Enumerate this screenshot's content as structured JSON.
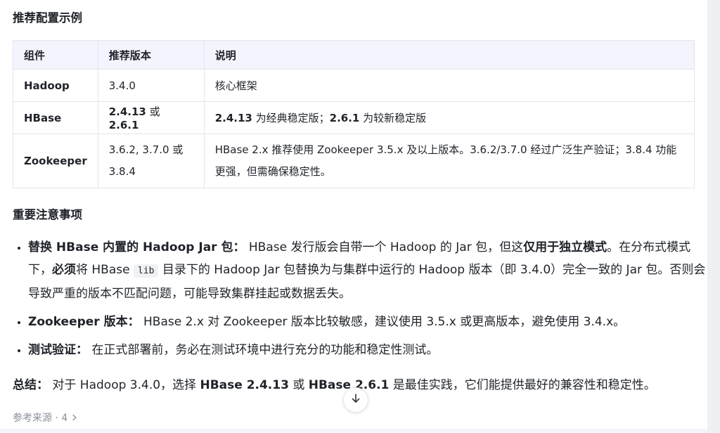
{
  "section1_title": "推荐配置示例",
  "table": {
    "headers": [
      "组件",
      "推荐版本",
      "说明"
    ],
    "rows": [
      {
        "component": "Hadoop",
        "version": "3.4.0",
        "note": "核心框架"
      },
      {
        "component": "HBase",
        "version_a": "2.4.13",
        "version_or": " 或 ",
        "version_b": "2.6.1",
        "note_a": "2.4.13",
        "note_a_text": " 为经典稳定版；",
        "note_b": "2.6.1",
        "note_b_text": " 为较新稳定版"
      },
      {
        "component": "Zookeeper",
        "version_line1": "3.6.2, 3.7.0 或",
        "version_line2": "3.8.4",
        "note_line1": "HBase 2.x 推荐使用 Zookeeper 3.5.x 及以上版本。3.6.2/3.7.0 经过广泛生产验证；3.8.4 功能",
        "note_line2": "更强，但需确保稳定性。"
      }
    ]
  },
  "section2_title": "重要注意事项",
  "notes": [
    {
      "title": "替换 HBase 内置的 Hadoop Jar 包：",
      "t1": " HBase 发行版会自带一个 Hadoop 的 Jar 包，但这",
      "b1": "仅用于独立模式",
      "t2": "。在分布式模式下，",
      "b2": "必须",
      "t3": "将 HBase ",
      "code": "lib",
      "t4": " 目录下的 Hadoop Jar 包替换为与集群中运行的 Hadoop 版本（即 3.4.0）完全一致的 Jar 包。否则会导致严重的版本不匹配问题，可能导致集群挂起或数据丢失。"
    },
    {
      "title": "Zookeeper 版本：",
      "text": " HBase 2.x 对 Zookeeper 版本比较敏感，建议使用 3.5.x 或更高版本，避免使用 3.4.x。"
    },
    {
      "title": "测试验证：",
      "text": " 在正式部署前，务必在测试环境中进行充分的功能和稳定性测试。"
    }
  ],
  "summary": {
    "label": "总结：",
    "t1": " 对于 Hadoop 3.4.0，选择 ",
    "b1": "HBase 2.4.13",
    "t2": " 或 ",
    "b2": "HBase 2.6.1",
    "t3": " 是最佳实践，它们能提供最好的兼容性和稳定性。"
  },
  "sources_label": "参考来源 · 4",
  "icons": {
    "scroll_down": "arrow-down-icon",
    "sources_chevron": "chevron-right-icon"
  }
}
